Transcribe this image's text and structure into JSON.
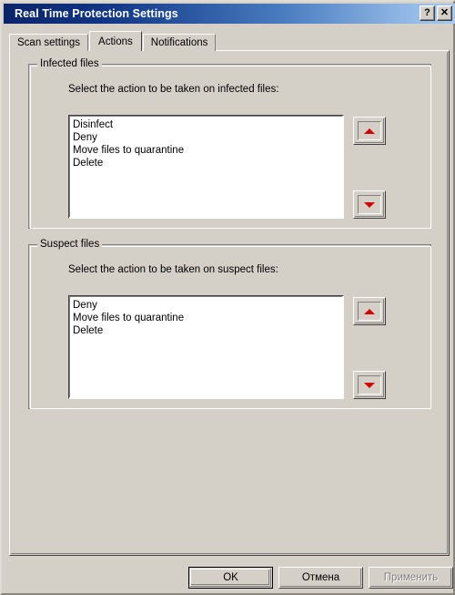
{
  "window": {
    "title": "Real Time Protection Settings",
    "titlebar_buttons": [
      {
        "name": "help-button",
        "glyph": "?"
      },
      {
        "name": "close-button",
        "glyph": "✕"
      }
    ],
    "colors": {
      "face": "#d4d0c8",
      "title_gradient_start": "#0a246a",
      "title_gradient_end": "#a6caf0",
      "arrow_red": "#d40000",
      "disabled_text": "#808080"
    }
  },
  "tabs": [
    {
      "label": "Scan settings",
      "active": false
    },
    {
      "label": "Actions",
      "active": true
    },
    {
      "label": "Notifications",
      "active": false
    }
  ],
  "groups": [
    {
      "legend": "Infected files",
      "caption": "Select the action to be taken on infected files:",
      "list_items": [
        "Disinfect",
        "Deny",
        "Move files to quarantine",
        "Delete"
      ],
      "move_up_label": "Move up",
      "move_down_label": "Move down"
    },
    {
      "legend": "Suspect files",
      "caption": "Select the action to be taken on suspect files:",
      "list_items": [
        "Deny",
        "Move files to quarantine",
        "Delete"
      ],
      "move_up_label": "Move up",
      "move_down_label": "Move down"
    }
  ],
  "footer": {
    "ok_label": "OK",
    "cancel_label": "Отмена",
    "apply_label": "Применить",
    "apply_enabled": false
  }
}
